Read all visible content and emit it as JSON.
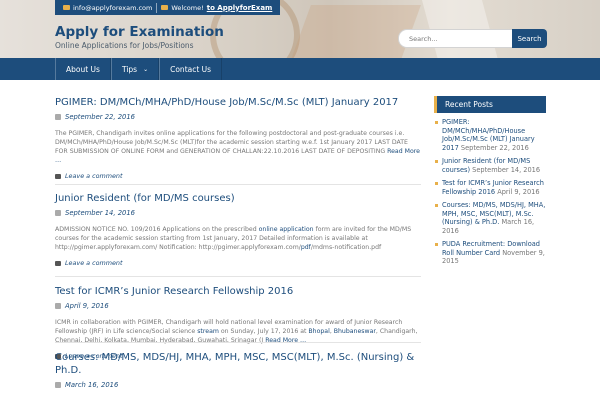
{
  "topbar": {
    "email": "info@applyforexam.com",
    "welcome": "Welcome!",
    "link": "to ApplyforExam"
  },
  "site": {
    "title": "Apply for Examination",
    "tagline": "Online Applications for Jobs/Positions"
  },
  "search": {
    "placeholder": "Search...",
    "button": "Search"
  },
  "nav": {
    "items": [
      "About Us",
      "Tips",
      "Contact Us"
    ]
  },
  "posts": [
    {
      "title": "PGIMER: DM/MCh/MHA/PhD/House Job/M.Sc/M.Sc (MLT) January 2017",
      "date": "September 22, 2016",
      "body": "The PGIMER, Chandigarh invites online applications for the following postdoctoral and post-graduate courses i.e. DM/MCh/MHA/PhD/House Job/M.Sc/M.Sc (MLT)for the academic session starting w.e.f. 1st January 2017 LAST DATE FOR SUBMISSION OF ONLINE FORM and GENERATION OF CHALLAN:22.10.2016 LAST DATE OF DEPOSITING",
      "read_more": "Read More …",
      "comment": "Leave a comment"
    },
    {
      "title": "Junior Resident (for MD/MS courses)",
      "date": "September 14, 2016",
      "body_a": "ADMISSION NOTICE NO. 109/2016 Applications on the prescribed ",
      "body_link1": "online application",
      "body_b": " form are invited for the MD/MS courses for the academic session starting from 1st January, 2017 Detailed information is available at http://pgimer.applyforexam.com/ Notification: http://pgimer.applyforexam.com/",
      "body_link2": "pdf",
      "body_c": "/mdms-notification.pdf",
      "comment": "Leave a comment"
    },
    {
      "title": "Test for ICMR’s Junior Research Fellowship 2016",
      "date": "April 9, 2016",
      "body_a": "ICMR in collaboration with PGIMER, Chandigarh will hold national level examination for award of Junior Research Fellowship (JRF) in Life science/Social science ",
      "body_link1": "stream",
      "body_b": " on Sunday, July 17, 2016 at ",
      "body_link2": "Bhopal",
      "body_c": ", ",
      "body_link3": "Bhubaneswar",
      "body_d": ", Chandigarh, Chennai, Delhi, Kolkata, Mumbai, Hyderabad, Guwahati, Srinagar (J",
      "read_more": "Read More …",
      "comment": "Leave a comment"
    },
    {
      "title": "Courses: MD/MS, MDS/HJ, MHA, MPH, MSC, MSC(MLT), M.Sc. (Nursing) & Ph.D.",
      "date": "March 16, 2016"
    }
  ],
  "sidebar": {
    "title": "Recent Posts",
    "items": [
      {
        "text": "PGIMER: DM/MCh/MHA/PhD/House Job/M.Sc/M.Sc (MLT) January 2017",
        "date": "September 22, 2016"
      },
      {
        "text": "Junior Resident (for MD/MS courses)",
        "date": "September 14, 2016"
      },
      {
        "text": "Test for ICMR’s Junior Research Fellowship 2016",
        "date": "April 9, 2016"
      },
      {
        "text": "Courses: MD/MS, MDS/HJ, MHA, MPH, MSC, MSC(MLT), M.Sc. (Nursing) & Ph.D.",
        "date": "March 16, 2016"
      },
      {
        "text": "PUDA Recruitment: Download Roll Number Card",
        "date": "November 9, 2015"
      }
    ]
  },
  "colors": {
    "brand": "#1d4d7c",
    "accent": "#e8b04a"
  }
}
